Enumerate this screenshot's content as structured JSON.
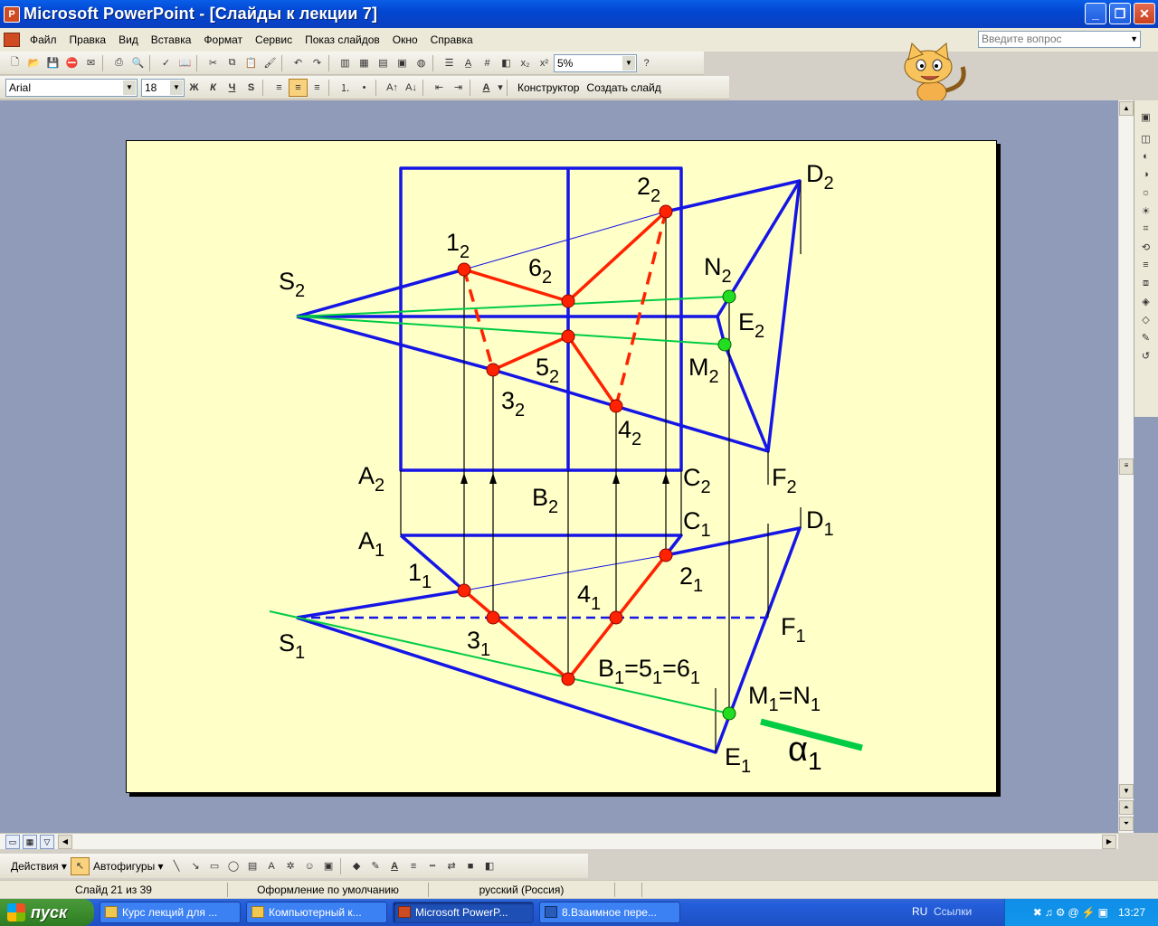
{
  "window": {
    "title": "Microsoft PowerPoint - [Слайды к лекции 7]",
    "app_icon": "powerpoint-icon"
  },
  "menu": {
    "items": [
      "Файл",
      "Правка",
      "Вид",
      "Вставка",
      "Формат",
      "Сервис",
      "Показ слайдов",
      "Окно",
      "Справка"
    ],
    "help_placeholder": "Введите вопрос"
  },
  "toolbar_standard": {
    "zoom": "5%"
  },
  "toolbar_format": {
    "font": "Arial",
    "size": "18",
    "bold": "Ж",
    "italic": "К",
    "underline": "Ч",
    "shadow": "S",
    "designer": "Конструктор",
    "new_slide": "Создать слайд"
  },
  "drawing_toolbar": {
    "actions": "Действия",
    "autoshapes": "Автофигуры"
  },
  "status": {
    "slide": "Слайд 21 из 39",
    "design": "Оформление по умолчанию",
    "language": "русский (Россия)"
  },
  "taskbar": {
    "start": "пуск",
    "tasks": [
      "Курс лекций для ...",
      "Компьютерный к...",
      "Microsoft PowerP...",
      "8.Взаимное пере..."
    ],
    "tray_lang": "RU",
    "tray_links": "Ссылки",
    "clock": "13:27"
  },
  "slide_labels": {
    "D2": {
      "main": "D",
      "sub": "2"
    },
    "2_2": {
      "main": "2",
      "sub": "2"
    },
    "1_2": {
      "main": "1",
      "sub": "2"
    },
    "6_2": {
      "main": "6",
      "sub": "2"
    },
    "N2": {
      "main": "N",
      "sub": "2"
    },
    "S2": {
      "main": "S",
      "sub": "2"
    },
    "E2": {
      "main": "E",
      "sub": "2"
    },
    "M2": {
      "main": "M",
      "sub": "2"
    },
    "5_2": {
      "main": "5",
      "sub": "2"
    },
    "3_2": {
      "main": "3",
      "sub": "2"
    },
    "4_2": {
      "main": "4",
      "sub": "2"
    },
    "A2": {
      "main": "A",
      "sub": "2"
    },
    "C2": {
      "main": "C",
      "sub": "2"
    },
    "B2": {
      "main": "B",
      "sub": "2"
    },
    "F2": {
      "main": "F",
      "sub": "2"
    },
    "C1": {
      "main": "C",
      "sub": "1"
    },
    "D1": {
      "main": "D",
      "sub": "1"
    },
    "A1": {
      "main": "A",
      "sub": "1"
    },
    "1_1": {
      "main": "1",
      "sub": "1"
    },
    "2_1": {
      "main": "2",
      "sub": "1"
    },
    "4_1": {
      "main": "4",
      "sub": "1"
    },
    "F1": {
      "main": "F",
      "sub": "1"
    },
    "S1": {
      "main": "S",
      "sub": "1"
    },
    "3_1": {
      "main": "3",
      "sub": "1"
    },
    "B1": {
      "main": "B",
      "sub": "1",
      "eq1": "=5",
      "sub1": "1",
      "eq2": "=6",
      "sub2": "1"
    },
    "M1": {
      "main": "M",
      "sub": "1",
      "eq1": "=N",
      "sub1": "1"
    },
    "E1": {
      "main": "E",
      "sub": "1"
    },
    "alpha": {
      "main": "α",
      "sub": "1"
    }
  },
  "colors": {
    "blue": "#1515e6",
    "red": "#ff2200",
    "green": "#00cc44",
    "slide_bg": "#ffffc8"
  }
}
